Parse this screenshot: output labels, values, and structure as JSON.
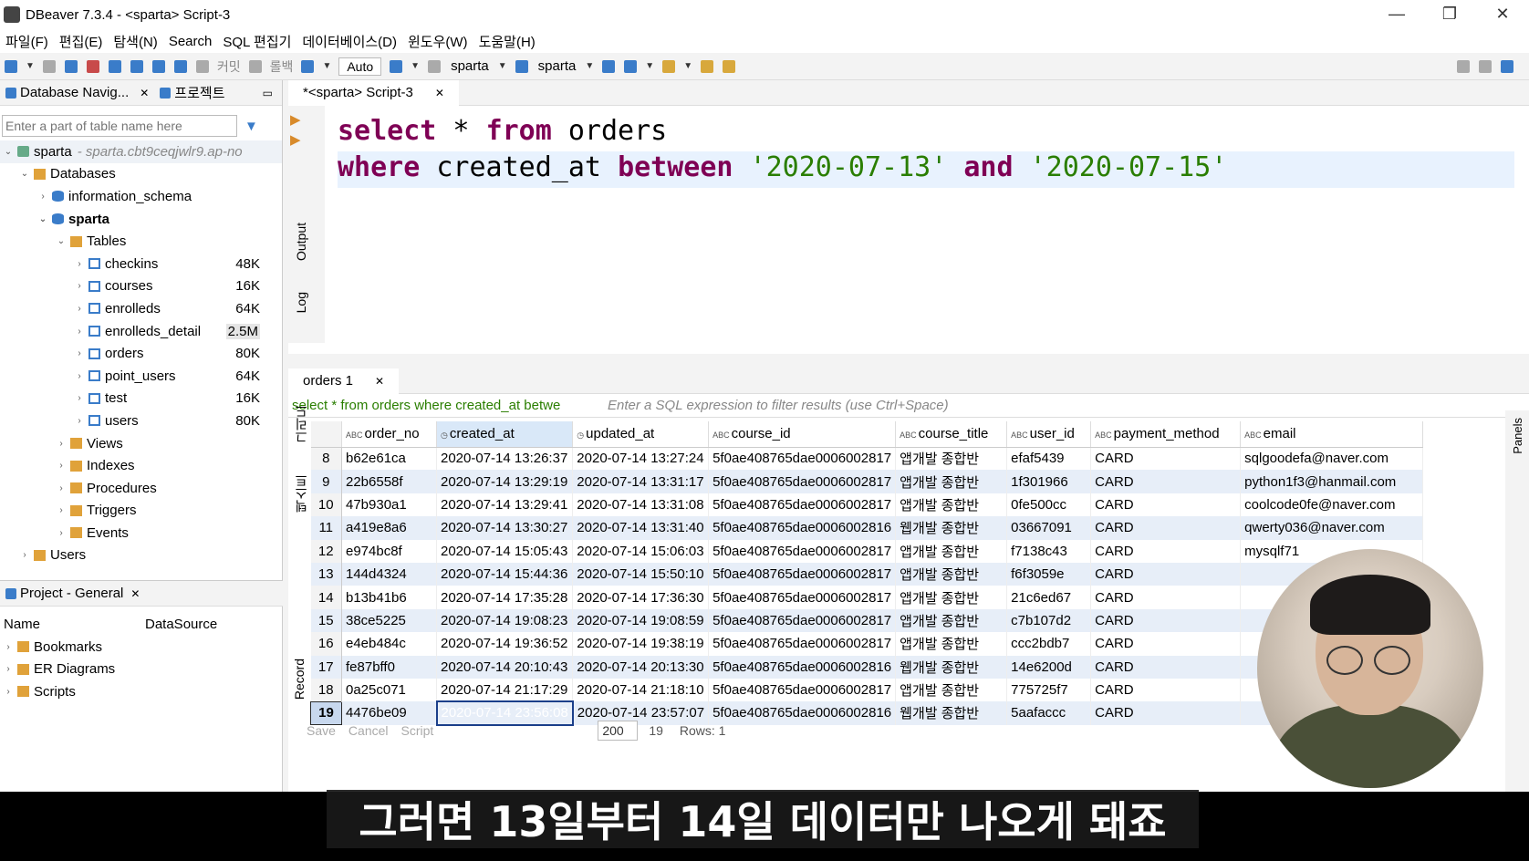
{
  "window": {
    "title": "DBeaver 7.3.4 - <sparta> Script-3",
    "minimize": "—",
    "restore": "❐",
    "close": "✕"
  },
  "menu": [
    "파일(F)",
    "편집(E)",
    "탐색(N)",
    "Search",
    "SQL 편집기",
    "데이터베이스(D)",
    "윈도우(W)",
    "도움말(H)"
  ],
  "toolbar": {
    "commit": "커밋",
    "rollback": "롤백",
    "tx_mode": "Auto",
    "datasource": "sparta",
    "schema": "sparta"
  },
  "navigator": {
    "tab_db": "Database Navig...",
    "tab_project": "프로젝트",
    "filter_placeholder": "Enter a part of table name here",
    "connection": "sparta",
    "connection_host": "- sparta.cbt9ceqjwlr9.ap-no",
    "databases": "Databases",
    "schema_info": "information_schema",
    "schema_sparta": "sparta",
    "tables_label": "Tables",
    "tables": [
      {
        "name": "checkins",
        "size": "48K"
      },
      {
        "name": "courses",
        "size": "16K"
      },
      {
        "name": "enrolleds",
        "size": "64K"
      },
      {
        "name": "enrolleds_detail",
        "size": "2.5M"
      },
      {
        "name": "orders",
        "size": "80K"
      },
      {
        "name": "point_users",
        "size": "64K"
      },
      {
        "name": "test",
        "size": "16K"
      },
      {
        "name": "users",
        "size": "80K"
      }
    ],
    "folders": [
      "Views",
      "Indexes",
      "Procedures",
      "Triggers",
      "Events"
    ],
    "users": "Users"
  },
  "project": {
    "title": "Project - General",
    "col_name": "Name",
    "col_ds": "DataSource",
    "items": [
      "Bookmarks",
      "ER Diagrams",
      "Scripts"
    ]
  },
  "editor": {
    "tab": "*<sparta> Script-3",
    "line1": {
      "k1": "select",
      "mid": " * ",
      "k2": "from",
      "rest": " orders"
    },
    "line2": {
      "k1": "where",
      "mid": " created_at ",
      "k2": "between",
      "s1": "'2020-07-13'",
      "k3": "and",
      "s2": "'2020-07-15'"
    },
    "side_output": "Output",
    "side_log": "Log"
  },
  "results": {
    "tab": "orders 1",
    "query": "select * from orders where created_at betwe",
    "filter_placeholder": "Enter a SQL expression to filter results (use Ctrl+Space)",
    "columns": [
      "order_no",
      "created_at",
      "updated_at",
      "course_id",
      "course_title",
      "user_id",
      "payment_method",
      "email"
    ],
    "rows": [
      [
        "8",
        "b62e61ca",
        "2020-07-14 13:26:37",
        "2020-07-14 13:27:24",
        "5f0ae408765dae0006002817",
        "앱개발 종합반",
        "efaf5439",
        "CARD",
        "sqlgoodefa@naver.com"
      ],
      [
        "9",
        "22b6558f",
        "2020-07-14 13:29:19",
        "2020-07-14 13:31:17",
        "5f0ae408765dae0006002817",
        "앱개발 종합반",
        "1f301966",
        "CARD",
        "python1f3@hanmail.com"
      ],
      [
        "10",
        "47b930a1",
        "2020-07-14 13:29:41",
        "2020-07-14 13:31:08",
        "5f0ae408765dae0006002817",
        "앱개발 종합반",
        "0fe500cc",
        "CARD",
        "coolcode0fe@naver.com"
      ],
      [
        "11",
        "a419e8a6",
        "2020-07-14 13:30:27",
        "2020-07-14 13:31:40",
        "5f0ae408765dae0006002816",
        "웹개발 종합반",
        "03667091",
        "CARD",
        "qwerty036@naver.com"
      ],
      [
        "12",
        "e974bc8f",
        "2020-07-14 15:05:43",
        "2020-07-14 15:06:03",
        "5f0ae408765dae0006002817",
        "앱개발 종합반",
        "f7138c43",
        "CARD",
        "mysqlf71"
      ],
      [
        "13",
        "144d4324",
        "2020-07-14 15:44:36",
        "2020-07-14 15:50:10",
        "5f0ae408765dae0006002817",
        "앱개발 종합반",
        "f6f3059e",
        "CARD",
        ""
      ],
      [
        "14",
        "b13b41b6",
        "2020-07-14 17:35:28",
        "2020-07-14 17:36:30",
        "5f0ae408765dae0006002817",
        "앱개발 종합반",
        "21c6ed67",
        "CARD",
        ""
      ],
      [
        "15",
        "38ce5225",
        "2020-07-14 19:08:23",
        "2020-07-14 19:08:59",
        "5f0ae408765dae0006002817",
        "앱개발 종합반",
        "c7b107d2",
        "CARD",
        ""
      ],
      [
        "16",
        "e4eb484c",
        "2020-07-14 19:36:52",
        "2020-07-14 19:38:19",
        "5f0ae408765dae0006002817",
        "앱개발 종합반",
        "ccc2bdb7",
        "CARD",
        ""
      ],
      [
        "17",
        "fe87bff0",
        "2020-07-14 20:10:43",
        "2020-07-14 20:13:30",
        "5f0ae408765dae0006002816",
        "웹개발 종합반",
        "14e6200d",
        "CARD",
        ""
      ],
      [
        "18",
        "0a25c071",
        "2020-07-14 21:17:29",
        "2020-07-14 21:18:10",
        "5f0ae408765dae0006002817",
        "앱개발 종합반",
        "775725f7",
        "CARD",
        ""
      ],
      [
        "19",
        "4476be09",
        "2020-07-14 23:56:08",
        "2020-07-14 23:57:07",
        "5f0ae408765dae0006002816",
        "웹개발 종합반",
        "5aafaccc",
        "CARD",
        ""
      ]
    ],
    "side_grid": "그리드",
    "side_text": "텍스트",
    "side_record": "Record",
    "panels": "Panels",
    "fetch_size": "200",
    "row_count": "19",
    "rows_label": "Rows: 1",
    "save": "Save",
    "cancel": "Cancel",
    "script": "Script"
  },
  "subtitle": "그러면 13일부터 14일 데이터만 나오게 돼죠"
}
